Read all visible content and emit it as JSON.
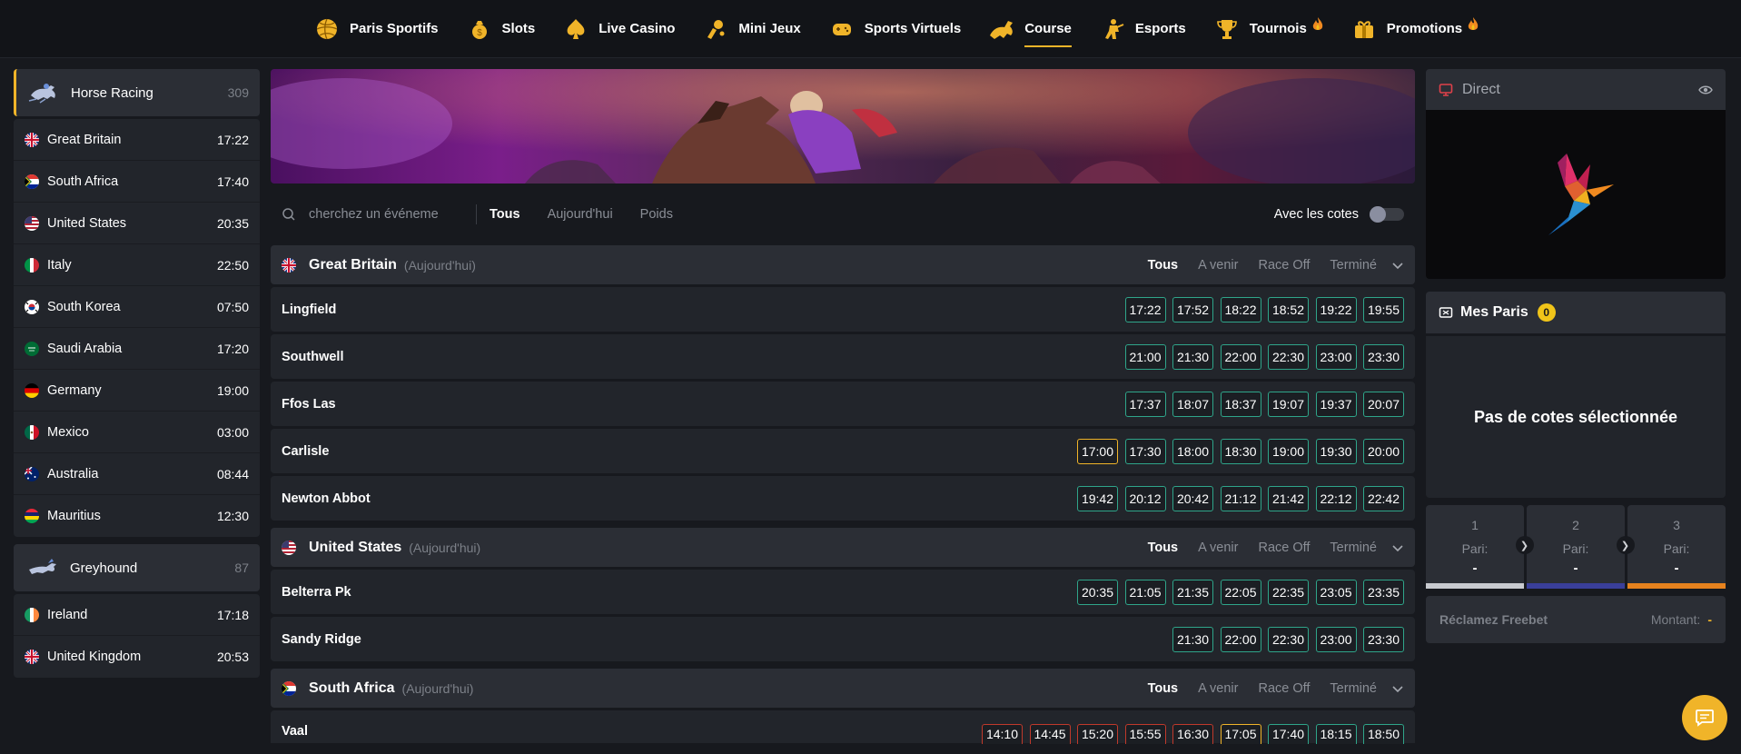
{
  "nav": {
    "items": [
      {
        "label": "Paris Sportifs",
        "icon": "football-icon"
      },
      {
        "label": "Slots",
        "icon": "coin-bag-icon"
      },
      {
        "label": "Live Casino",
        "icon": "spade-icon"
      },
      {
        "label": "Mini Jeux",
        "icon": "joystick-icon"
      },
      {
        "label": "Sports Virtuels",
        "icon": "gamepad-icon"
      },
      {
        "label": "Course",
        "icon": "horse-icon",
        "active": true
      },
      {
        "label": "Esports",
        "icon": "soldier-icon"
      },
      {
        "label": "Tournois",
        "icon": "trophy-icon",
        "hot": true
      },
      {
        "label": "Promotions",
        "icon": "gift-icon",
        "hot": true
      }
    ]
  },
  "sidebar": {
    "horse": {
      "title": "Horse Racing",
      "count": "309"
    },
    "horse_items": [
      {
        "name": "Great Britain",
        "time": "17:22",
        "flag": "gb"
      },
      {
        "name": "South Africa",
        "time": "17:40",
        "flag": "za"
      },
      {
        "name": "United States",
        "time": "20:35",
        "flag": "us"
      },
      {
        "name": "Italy",
        "time": "22:50",
        "flag": "it"
      },
      {
        "name": "South Korea",
        "time": "07:50",
        "flag": "kr"
      },
      {
        "name": "Saudi Arabia",
        "time": "17:20",
        "flag": "sa"
      },
      {
        "name": "Germany",
        "time": "19:00",
        "flag": "de"
      },
      {
        "name": "Mexico",
        "time": "03:00",
        "flag": "mx"
      },
      {
        "name": "Australia",
        "time": "08:44",
        "flag": "au"
      },
      {
        "name": "Mauritius",
        "time": "12:30",
        "flag": "mu"
      }
    ],
    "greyhound": {
      "title": "Greyhound",
      "count": "87"
    },
    "greyhound_items": [
      {
        "name": "Ireland",
        "time": "17:18",
        "flag": "ie"
      },
      {
        "name": "United Kingdom",
        "time": "20:53",
        "flag": "gb"
      }
    ]
  },
  "filters": {
    "search_placeholder": "cherchez un événeme",
    "tabs": [
      "Tous",
      "Aujourd'hui",
      "Poids"
    ],
    "toggle_label": "Avec les cotes"
  },
  "section_tabs": [
    "Tous",
    "A venir",
    "Race Off",
    "Terminé"
  ],
  "sections": [
    {
      "title": "Great Britain",
      "sub": "(Aujourd'hui)",
      "flag": "gb",
      "rows": [
        {
          "name": "Lingfield",
          "times": [
            "17:22",
            "17:52",
            "18:22",
            "18:52",
            "19:22",
            "19:55"
          ]
        },
        {
          "name": "Southwell",
          "times": [
            "21:00",
            "21:30",
            "22:00",
            "22:30",
            "23:00",
            "23:30"
          ]
        },
        {
          "name": "Ffos Las",
          "times": [
            "17:37",
            "18:07",
            "18:37",
            "19:07",
            "19:37",
            "20:07"
          ]
        },
        {
          "name": "Carlisle",
          "times": [
            "17:00",
            "17:30",
            "18:00",
            "18:30",
            "19:00",
            "19:30",
            "20:00"
          ],
          "gold": [
            0
          ]
        },
        {
          "name": "Newton Abbot",
          "times": [
            "19:42",
            "20:12",
            "20:42",
            "21:12",
            "21:42",
            "22:12",
            "22:42"
          ]
        }
      ]
    },
    {
      "title": "United States",
      "sub": "(Aujourd'hui)",
      "flag": "us",
      "rows": [
        {
          "name": "Belterra Pk",
          "times": [
            "20:35",
            "21:05",
            "21:35",
            "22:05",
            "22:35",
            "23:05",
            "23:35"
          ]
        },
        {
          "name": "Sandy Ridge",
          "times": [
            "21:30",
            "22:00",
            "22:30",
            "23:00",
            "23:30"
          ]
        }
      ]
    },
    {
      "title": "South Africa",
      "sub": "(Aujourd'hui)",
      "flag": "za",
      "rows": [
        {
          "name": "Vaal",
          "times": [
            "14:10",
            "14:45",
            "15:20",
            "15:55",
            "16:30",
            "17:05",
            "17:40",
            "18:15",
            "18:50"
          ],
          "red": [
            0,
            1,
            2,
            3,
            4
          ],
          "gold": [
            5
          ],
          "partial": true
        }
      ]
    }
  ],
  "right": {
    "direct_title": "Direct",
    "mes_paris": "Mes Paris",
    "mes_paris_count": "0",
    "empty_text": "Pas de cotes sélectionnée",
    "steps": [
      {
        "num": "1",
        "label": "Pari:",
        "value": "-",
        "color": "#c8cacf"
      },
      {
        "num": "2",
        "label": "Pari:",
        "value": "-",
        "color": "#3a3f9a"
      },
      {
        "num": "3",
        "label": "Pari:",
        "value": "-",
        "color": "#e6821e"
      }
    ],
    "freebet_label": "Réclamez Freebet",
    "montant_label": "Montant:",
    "montant_value": "-"
  },
  "colors": {
    "accent": "#f0b429",
    "time_border": "#2fa58a"
  }
}
